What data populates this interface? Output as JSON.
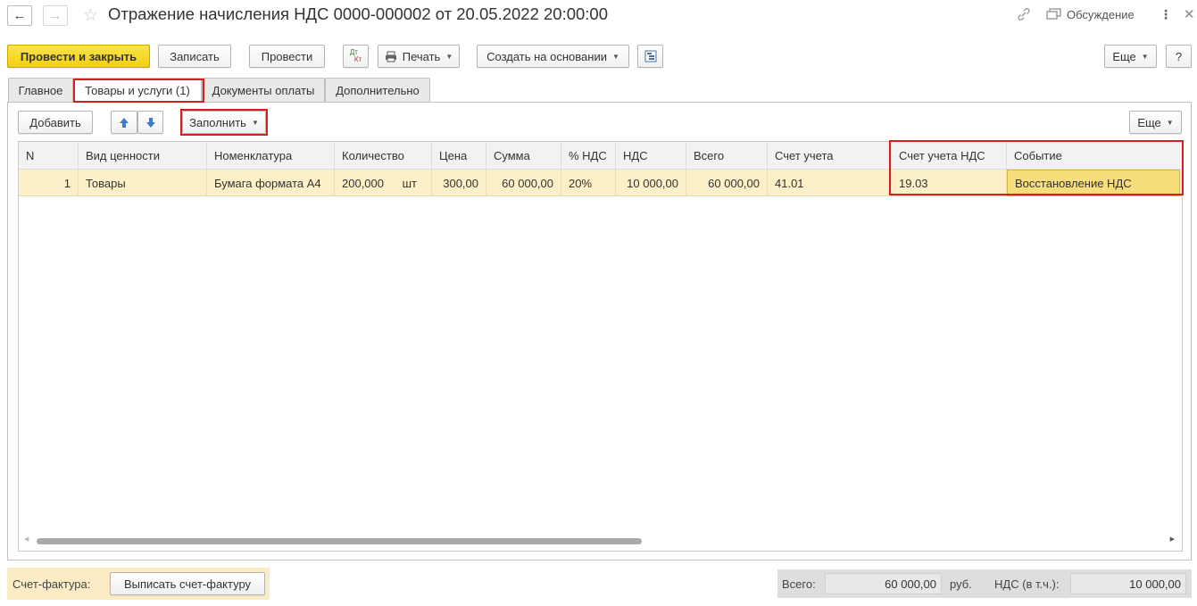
{
  "window": {
    "title": "Отражение начисления НДС 0000-000002 от 20.05.2022 20:00:00",
    "discussion_label": "Обсуждение"
  },
  "toolbar": {
    "post_and_close": "Провести и закрыть",
    "save": "Записать",
    "post": "Провести",
    "dt_kt_top": "Дт",
    "dt_kt_bottom": "Кт",
    "print": "Печать",
    "create_based_on": "Создать на основании",
    "more": "Еще",
    "help": "?"
  },
  "tabs": [
    {
      "label": "Главное",
      "active": false
    },
    {
      "label": "Товары и услуги (1)",
      "active": true
    },
    {
      "label": "Документы оплаты",
      "active": false
    },
    {
      "label": "Дополнительно",
      "active": false
    }
  ],
  "table_toolbar": {
    "add": "Добавить",
    "fill": "Заполнить",
    "more": "Еще"
  },
  "table": {
    "columns": [
      "N",
      "Вид ценности",
      "Номенклатура",
      "Количество",
      "Цена",
      "Сумма",
      "% НДС",
      "НДС",
      "Всего",
      "Счет учета",
      "Счет учета НДС",
      "Событие"
    ],
    "rows": [
      {
        "n": "1",
        "value_type": "Товары",
        "item": "Бумага формата А4",
        "quantity": "200,000",
        "unit": "шт",
        "price": "300,00",
        "sum": "60 000,00",
        "vat_rate": "20%",
        "vat": "10 000,00",
        "total": "60 000,00",
        "account": "41.01",
        "vat_account": "19.03",
        "event": "Восстановление НДС"
      }
    ]
  },
  "footer": {
    "invoice_label": "Счет-фактура:",
    "invoice_button": "Выписать счет-фактуру",
    "total_label": "Всего:",
    "total_value": "60 000,00",
    "currency": "руб.",
    "vat_label": "НДС (в т.ч.):",
    "vat_value": "10 000,00"
  },
  "colors": {
    "primary_button": "#f5d421",
    "highlight_border": "#d42020",
    "selected_row": "#fbf0c8"
  }
}
